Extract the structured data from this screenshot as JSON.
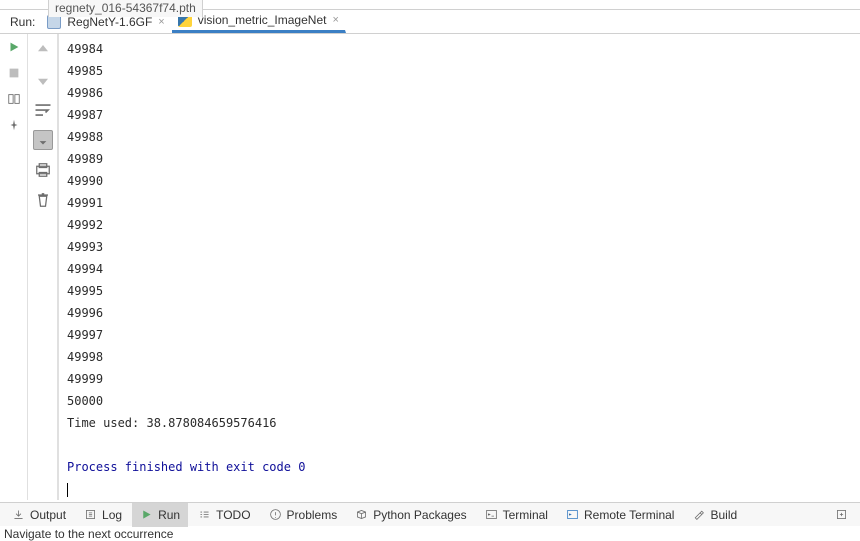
{
  "top_tab": "regnety_016-54367f74.pth",
  "run_label": "Run:",
  "tabs": [
    {
      "label": "RegNetY-1.6GF",
      "active": false
    },
    {
      "label": "vision_metric_ImageNet",
      "active": true
    }
  ],
  "console_lines": [
    "49984",
    "49985",
    "49986",
    "49987",
    "49988",
    "49989",
    "49990",
    "49991",
    "49992",
    "49993",
    "49994",
    "49995",
    "49996",
    "49997",
    "49998",
    "49999",
    "50000",
    "Time used: 38.878084659576416",
    "",
    ""
  ],
  "process_line": "Process finished with exit code 0",
  "bottom": {
    "output": "Output",
    "log": "Log",
    "run": "Run",
    "todo": "TODO",
    "problems": "Problems",
    "packages": "Python Packages",
    "terminal": "Terminal",
    "remote": "Remote Terminal",
    "build": "Build"
  },
  "status": "Navigate to the next occurrence"
}
